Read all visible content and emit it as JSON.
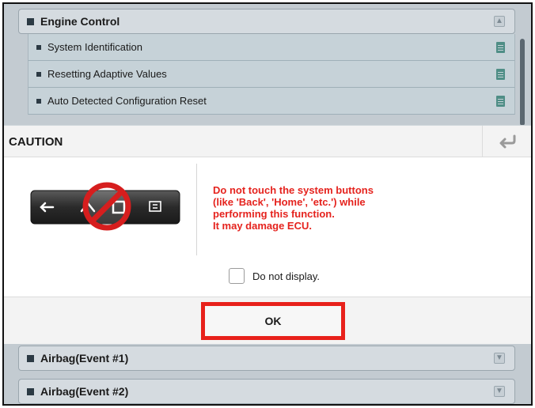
{
  "background_list": {
    "group1": {
      "title": "Engine Control",
      "icon": "collapse-icon"
    },
    "items": [
      {
        "label": "System Identification",
        "icon": "document-icon"
      },
      {
        "label": "Resetting Adaptive Values",
        "icon": "document-icon"
      },
      {
        "label": "Auto Detected Configuration Reset",
        "icon": "document-icon"
      }
    ],
    "group2": {
      "title": "Airbag(Event #1)",
      "icon": "expand-icon"
    },
    "group3": {
      "title": "Airbag(Event #2)",
      "icon": "expand-icon"
    }
  },
  "dialog": {
    "title": "CAUTION",
    "back_icon": "return-arrow-icon",
    "warning_lines": [
      "Do not touch the system buttons",
      "(like 'Back', 'Home', 'etc.') while",
      "performing this function.",
      "It may damage ECU."
    ],
    "checkbox_label": "Do not display.",
    "ok_label": "OK"
  },
  "colors": {
    "warning_text": "#e5231e",
    "highlight_border": "#e8211b",
    "list_background": "#c3cbd1",
    "doc_icon": "#4f8e86"
  }
}
